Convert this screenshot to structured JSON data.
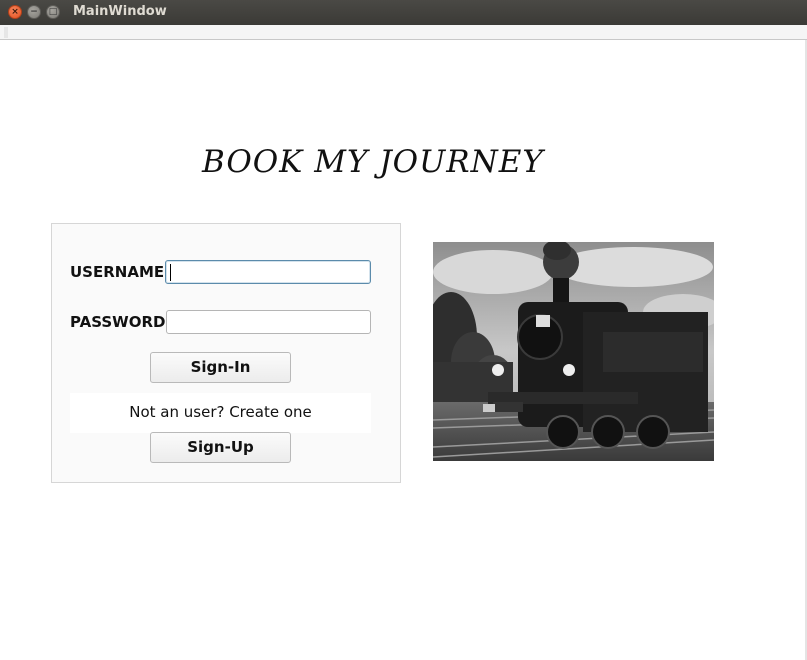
{
  "window": {
    "title": "MainWindow",
    "controls": {
      "close_glyph": "×",
      "min_glyph": "−",
      "max_glyph": "□"
    }
  },
  "heading": "BOOK  MY  JOURNEY",
  "login": {
    "username_label": "USERNAME",
    "username_value": "",
    "password_label": "PASSWORD",
    "password_value": "",
    "signin_label": "Sign-In",
    "create_prompt": "Not an user? Create one",
    "signup_label": "Sign-Up"
  },
  "image": {
    "icon": "steam-locomotive-photo",
    "style": "grayscale"
  },
  "colors": {
    "titlebar": "#3c3b37",
    "close_button": "#e95420",
    "focus_border": "#5b8bab"
  }
}
